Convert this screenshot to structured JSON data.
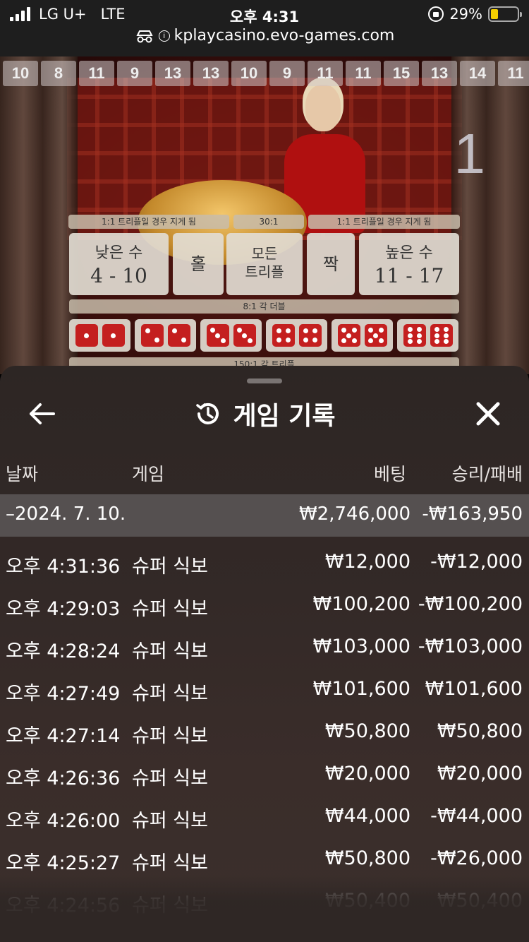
{
  "status_bar": {
    "carrier": "LG U+",
    "network": "LTE",
    "time": "오후 4:31",
    "battery": "29%",
    "battery_level": 0.29,
    "url": "kplaycasino.evo-games.com"
  },
  "game": {
    "history": [
      "10",
      "8",
      "11",
      "9",
      "13",
      "13",
      "10",
      "9",
      "11",
      "11",
      "15",
      "13",
      "14",
      "11"
    ],
    "timer_digit": "1",
    "odds": {
      "small": "1:1 트리플일 경우 지게 됨",
      "any_triple": "30:1",
      "big": "1:1 트리플일 경우 지게 됨",
      "doubles": "8:1 각 더블",
      "triples": "150:1 각 트리플"
    },
    "bets": {
      "small_label": "낮은 수",
      "small_range": "4 - 10",
      "odd": "홀",
      "any_triple_line1": "모든",
      "any_triple_line2": "트리플",
      "even": "짝",
      "big_label": "높은 수",
      "big_range": "11 - 17"
    },
    "doubles": [
      1,
      2,
      3,
      4,
      5,
      6
    ],
    "colors": {
      "die": "#c41f1f",
      "accent_red": "#b01010"
    }
  },
  "sheet": {
    "title": "게임 기록",
    "columns": {
      "date": "날짜",
      "game": "게임",
      "bet": "베팅",
      "result": "승리/패배"
    },
    "date_group": {
      "date": "–2024. 7. 10.",
      "bet_total": "₩2,746,000",
      "result_total": "-₩163,950"
    },
    "rows": [
      {
        "time": "오후 4:31:36",
        "game": "슈퍼 식보",
        "bet": "₩12,000",
        "result": "-₩12,000"
      },
      {
        "time": "오후 4:29:03",
        "game": "슈퍼 식보",
        "bet": "₩100,200",
        "result": "-₩100,200"
      },
      {
        "time": "오후 4:28:24",
        "game": "슈퍼 식보",
        "bet": "₩103,000",
        "result": "-₩103,000"
      },
      {
        "time": "오후 4:27:49",
        "game": "슈퍼 식보",
        "bet": "₩101,600",
        "result": "₩101,600"
      },
      {
        "time": "오후 4:27:14",
        "game": "슈퍼 식보",
        "bet": "₩50,800",
        "result": "₩50,800"
      },
      {
        "time": "오후 4:26:36",
        "game": "슈퍼 식보",
        "bet": "₩20,000",
        "result": "₩20,000"
      },
      {
        "time": "오후 4:26:00",
        "game": "슈퍼 식보",
        "bet": "₩44,000",
        "result": "-₩44,000"
      },
      {
        "time": "오후 4:25:27",
        "game": "슈퍼 식보",
        "bet": "₩50,800",
        "result": "-₩26,000"
      },
      {
        "time": "오후 4:24:56",
        "game": "슈퍼 식보",
        "bet": "₩50,400",
        "result": "₩50,400"
      }
    ]
  }
}
